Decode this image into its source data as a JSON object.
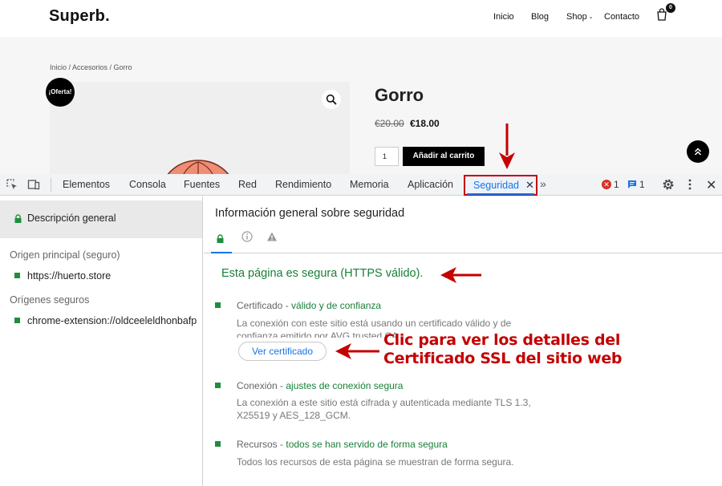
{
  "site": {
    "logo": "Superb.",
    "nav": {
      "inicio": "Inicio",
      "blog": "Blog",
      "shop": "Shop",
      "contacto": "Contacto"
    },
    "cart_count": "0",
    "breadcrumb": "Inicio / Accesorios / Gorro",
    "sale_badge": "¡Oferta!",
    "product": {
      "title": "Gorro",
      "price_old": "€20.00",
      "price_new": "€18.00",
      "quantity": "1",
      "add_to_cart": "Añadir al carrito"
    }
  },
  "devtools": {
    "tabs": {
      "elementos": "Elementos",
      "consola": "Consola",
      "fuentes": "Fuentes",
      "red": "Red",
      "rendimiento": "Rendimiento",
      "memoria": "Memoria",
      "aplicacion": "Aplicación",
      "seguridad": "Seguridad"
    },
    "error_count": "1",
    "message_count": "1",
    "sidebar": {
      "overview": "Descripción general",
      "main_origin_heading": "Origen principal (seguro)",
      "main_origin": "https://huerto.store",
      "secure_origins_heading": "Orígenes seguros",
      "secure_origin": "chrome-extension://oldceeleldhonbafp"
    },
    "main": {
      "title": "Información general sobre seguridad",
      "secure_message": "Esta página es segura (HTTPS válido).",
      "certificate": {
        "name": "Certificado",
        "status": "válido y de confianza",
        "description": "La conexión con este sitio está usando un certificado válido y de confianza emitido por AVG trusted CA.",
        "button": "Ver certificado"
      },
      "connection": {
        "name": "Conexión",
        "status": "ajustes de conexión segura",
        "description": "La conexión a este sitio está cifrada y autenticada mediante TLS 1.3, X25519 y AES_128_GCM."
      },
      "resources": {
        "name": "Recursos",
        "status": "todos se han servido de forma segura",
        "description": "Todos los recursos de esta página se muestran de forma segura."
      }
    }
  },
  "annotation": {
    "line1": "Clic para ver los detalles del",
    "line2": "Certificado SSL del sitio web"
  },
  "icons": {
    "separator": " - ",
    "caret": "⌄",
    "close": "✕",
    "more": "»"
  },
  "colors": {
    "secure_green": "#188038",
    "link_blue": "#1a73e8",
    "annotation_red": "#c40000",
    "error_red": "#d93025"
  }
}
